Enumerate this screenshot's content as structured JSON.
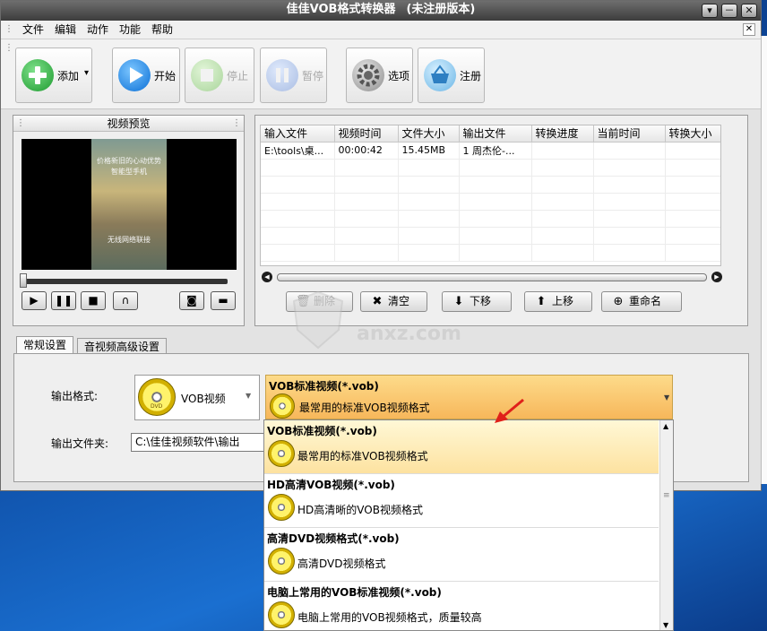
{
  "window": {
    "title": "佳佳VOB格式转换器",
    "title_suffix": "(未注册版本)",
    "controls": [
      "▾",
      "－",
      "✕"
    ]
  },
  "menu": {
    "items": [
      "文件",
      "编辑",
      "动作",
      "功能",
      "帮助"
    ],
    "close": "✕"
  },
  "toolbar": {
    "add": "添加",
    "add_arrow": "▾",
    "start": "开始",
    "stop": "停止",
    "pause": "暂停",
    "options": "选项",
    "register": "注册"
  },
  "preview": {
    "title": "视频预览",
    "overlay_lines": [
      "价格新旧的心动优势",
      "智能型手机",
      "无线网络联接"
    ]
  },
  "file_list": {
    "columns": [
      "输入文件",
      "视频时间",
      "文件大小",
      "输出文件",
      "转换进度",
      "当前时间",
      "转换大小"
    ],
    "rows": [
      [
        "E:\\tools\\桌...",
        "00:00:42",
        "15.45MB",
        "1 周杰伦-...",
        "",
        "",
        ""
      ]
    ],
    "buttons": {
      "delete": "删除",
      "clear": "清空",
      "move_down": "下移",
      "move_up": "上移",
      "rename": "重命名"
    }
  },
  "settings": {
    "tabs": [
      "常规设置",
      "音视频高级设置"
    ],
    "output_format_label": "输出格式:",
    "output_folder_label": "输出文件夹:",
    "format_value": "VOB视频",
    "format_disc_text": "DVD",
    "selected_preset": {
      "name": "VOB标准视频(*.vob)",
      "desc": "最常用的标准VOB视频格式"
    },
    "output_folder": "C:\\佳佳视频软件\\输出"
  },
  "dropdown": {
    "items": [
      {
        "name": "VOB标准视频(*.vob)",
        "desc": "最常用的标准VOB视频格式"
      },
      {
        "name": "HD高清VOB视频(*.vob)",
        "desc": "HD高清晰的VOB视频格式"
      },
      {
        "name": "高清DVD视频格式(*.vob)",
        "desc": "高清DVD视频格式"
      },
      {
        "name": "电脑上常用的VOB标准视频(*.vob)",
        "desc": "电脑上常用的VOB视频格式，质量较高"
      }
    ]
  },
  "watermark": {
    "domain": "anxz.com"
  },
  "colors": {
    "accent_orange": "#f7b75b",
    "selected_row": "#fde2a0",
    "title_bar": "#3c3c3c",
    "desktop_blue": "#0d4aa0"
  }
}
